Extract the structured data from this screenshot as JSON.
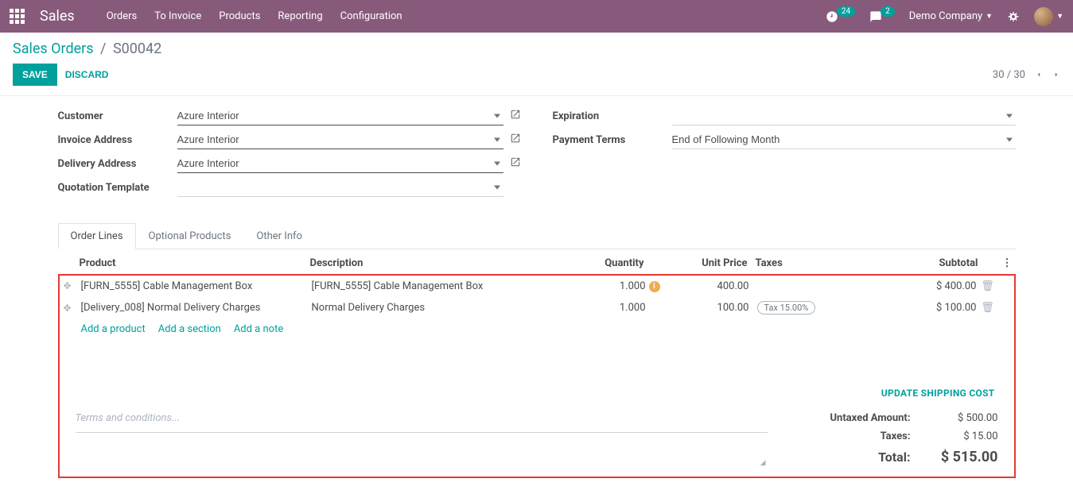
{
  "nav": {
    "brand": "Sales",
    "links": [
      "Orders",
      "To Invoice",
      "Products",
      "Reporting",
      "Configuration"
    ],
    "activity_badge": "24",
    "message_badge": "2",
    "company": "Demo Company"
  },
  "breadcrumb": {
    "root": "Sales Orders",
    "current": "S00042"
  },
  "buttons": {
    "save": "SAVE",
    "discard": "DISCARD"
  },
  "pager": {
    "pos": "30",
    "total": "30"
  },
  "form": {
    "labels": {
      "customer": "Customer",
      "invoice_address": "Invoice Address",
      "delivery_address": "Delivery Address",
      "quotation_template": "Quotation Template",
      "expiration": "Expiration",
      "payment_terms": "Payment Terms"
    },
    "values": {
      "customer": "Azure Interior",
      "invoice_address": "Azure Interior",
      "delivery_address": "Azure Interior",
      "quotation_template": "",
      "expiration": "",
      "payment_terms": "End of Following Month"
    }
  },
  "tabs": {
    "order_lines": "Order Lines",
    "optional": "Optional Products",
    "other": "Other Info"
  },
  "columns": {
    "product": "Product",
    "description": "Description",
    "quantity": "Quantity",
    "unit_price": "Unit Price",
    "taxes": "Taxes",
    "subtotal": "Subtotal"
  },
  "lines": [
    {
      "product": "[FURN_5555] Cable Management Box",
      "description": "[FURN_5555] Cable Management Box",
      "qty": "1.000",
      "warn": true,
      "price": "400.00",
      "tax": "",
      "subtotal": "$ 400.00"
    },
    {
      "product": "[Delivery_008] Normal Delivery Charges",
      "description": "Normal Delivery Charges",
      "qty": "1.000",
      "warn": false,
      "price": "100.00",
      "tax": "Tax 15.00%",
      "subtotal": "$ 100.00"
    }
  ],
  "add": {
    "product": "Add a product",
    "section": "Add a section",
    "note": "Add a note"
  },
  "update_shipping": "UPDATE SHIPPING COST",
  "terms_placeholder": "Terms and conditions...",
  "totals": {
    "untaxed_label": "Untaxed Amount:",
    "untaxed_val": "$ 500.00",
    "taxes_label": "Taxes:",
    "taxes_val": "$ 15.00",
    "total_label": "Total:",
    "total_val": "$ 515.00"
  }
}
